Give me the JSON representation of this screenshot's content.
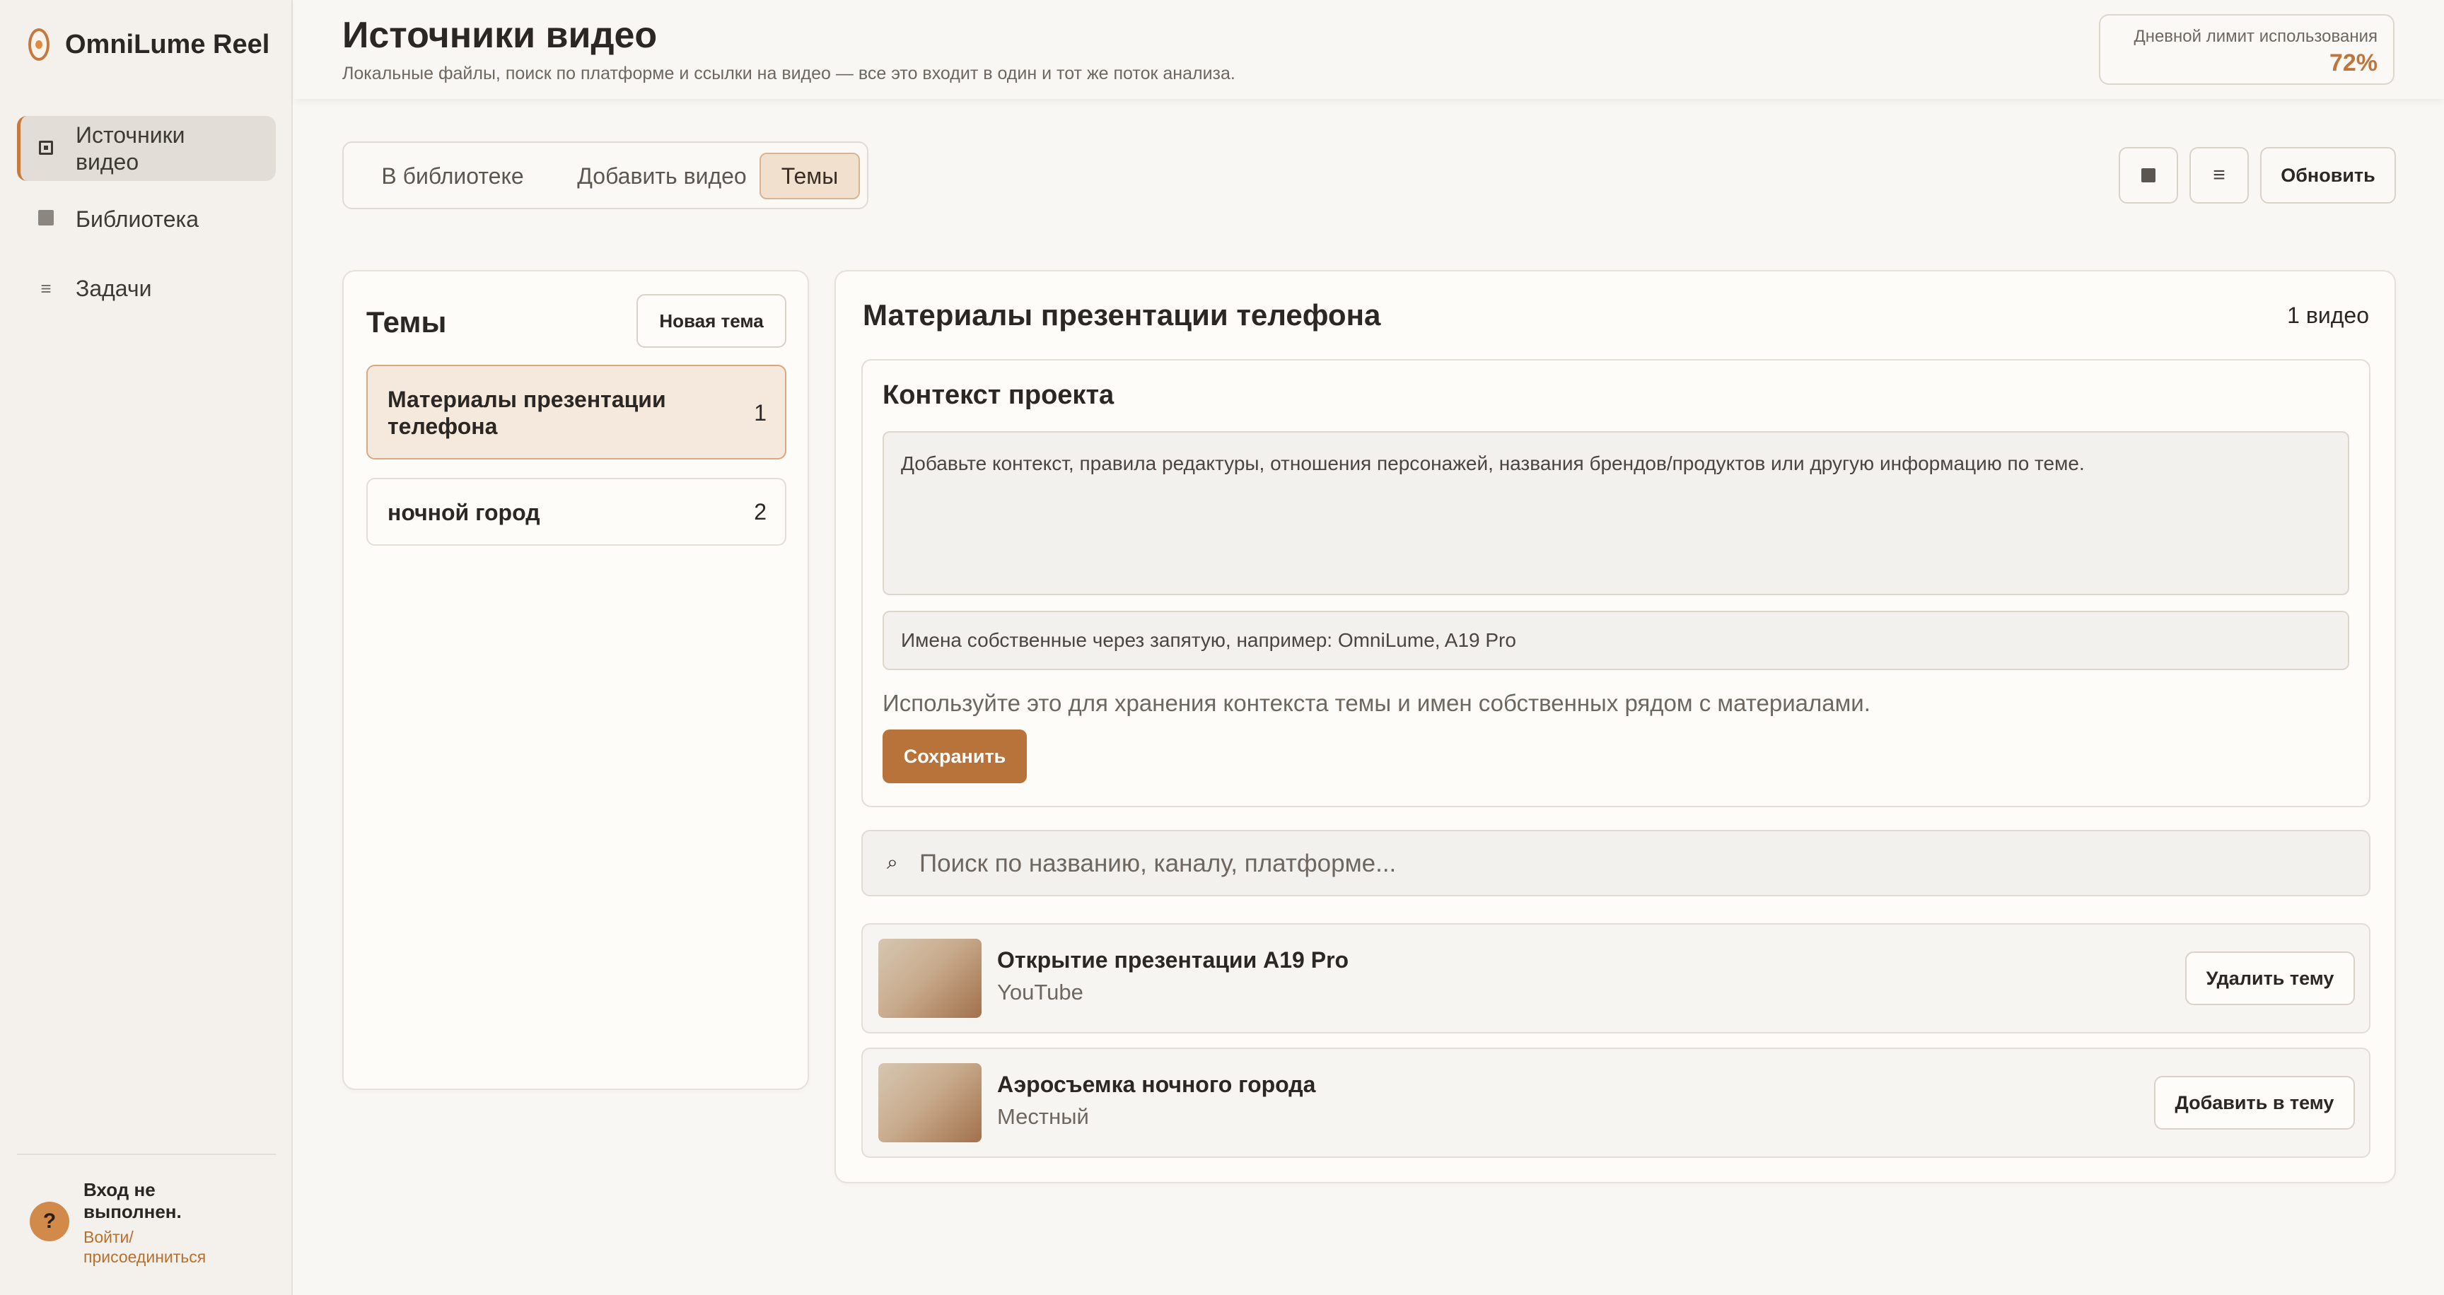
{
  "app": {
    "name": "OmniLume Reel"
  },
  "sidebar": {
    "items": [
      {
        "label": "Источники видео",
        "icon": "square-outline-icon"
      },
      {
        "label": "Библиотека",
        "icon": "square-icon"
      },
      {
        "label": "Задачи",
        "icon": "list-icon"
      }
    ],
    "login": {
      "badge": "?",
      "title": "Вход не выполнен.",
      "link": "Войти/присоединиться"
    }
  },
  "header": {
    "title": "Источники видео",
    "subtitle": "Локальные файлы, поиск по платформе и ссылки на видео — все это входит в один и тот же поток анализа.",
    "usage_label": "Дневной лимит использования",
    "usage_value": "72%"
  },
  "tabs": [
    "В библиотеке",
    "Добавить видео",
    "Темы"
  ],
  "toolbar": {
    "list_icon": "≡",
    "refresh": "Обновить"
  },
  "topics": {
    "title": "Темы",
    "new_button": "Новая тема",
    "items": [
      {
        "name": "Материалы презентации телефона",
        "count": "1"
      },
      {
        "name": "ночной город",
        "count": "2"
      }
    ]
  },
  "detail": {
    "title": "Материалы презентации телефона",
    "video_count": "1 видео",
    "context": {
      "title": "Контекст проекта",
      "placeholder": "Добавьте контекст, правила редактуры, отношения персонажей, названия брендов/продуктов или другую информацию по теме.",
      "names_placeholder": "Имена собственные через запятую, например: OmniLume, A19 Pro",
      "hint": "Используйте это для хранения контекста темы и имен собственных рядом с материалами.",
      "save": "Сохранить"
    },
    "search": {
      "icon": "⌕",
      "placeholder": "Поиск по названию, каналу, платформе..."
    },
    "videos": [
      {
        "title": "Открытие презентации A19 Pro",
        "source": "YouTube",
        "action": "Удалить тему"
      },
      {
        "title": "Аэросъемка ночного города",
        "source": "Местный",
        "action": "Добавить в тему"
      }
    ]
  },
  "colors": {
    "accent": "#b8733a",
    "selected_bg": "#f5e8dc",
    "usage": "#c0763a"
  }
}
